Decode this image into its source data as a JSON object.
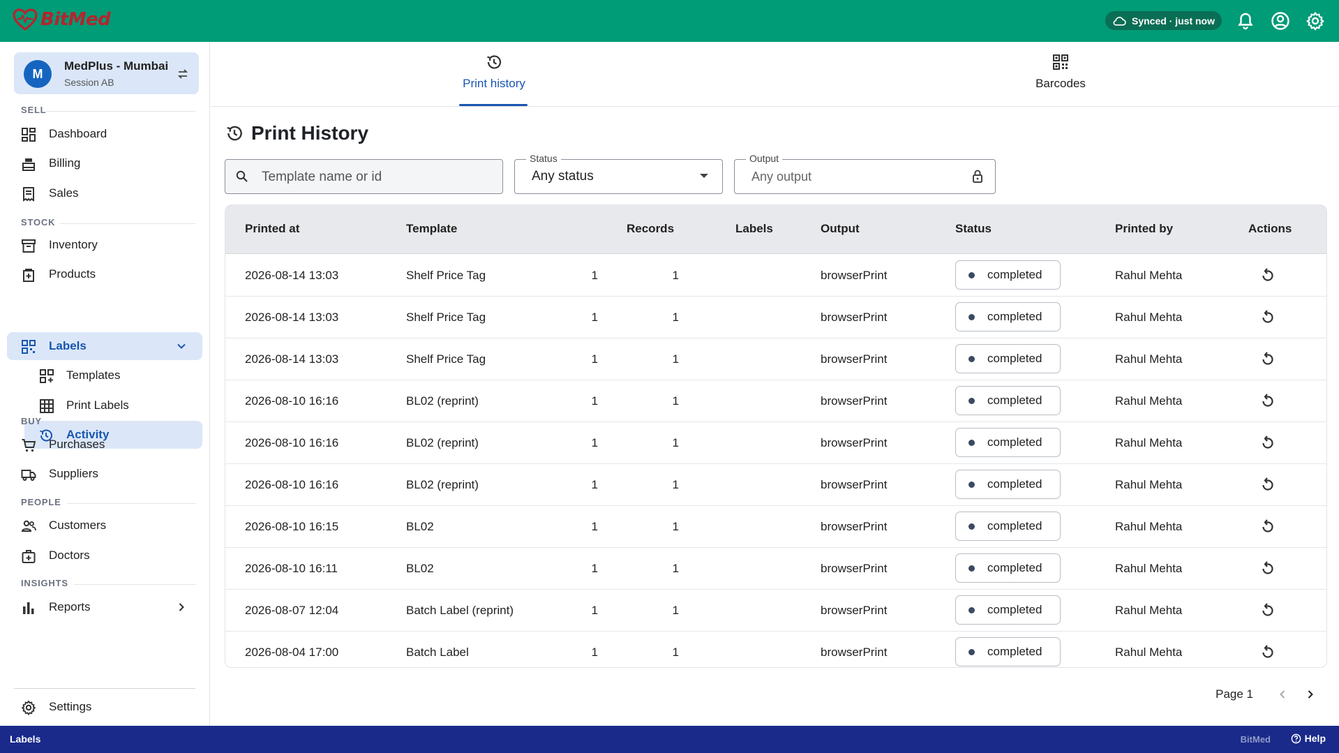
{
  "app": {
    "name": "BitMed"
  },
  "topbar": {
    "sync_text": "Synced · just now",
    "icons": [
      "cloud-icon",
      "bell-icon",
      "account-icon",
      "gear-icon"
    ]
  },
  "store": {
    "avatar": "M",
    "name": "MedPlus - Mumbai",
    "session": "Session AB"
  },
  "sidebar": {
    "sections": {
      "sell": "SELL",
      "stock": "STOCK",
      "buy": "BUY",
      "people": "PEOPLE",
      "insights": "INSIGHTS"
    },
    "items": {
      "dashboard": "Dashboard",
      "billing": "Billing",
      "sales": "Sales",
      "inventory": "Inventory",
      "products": "Products",
      "labels": "Labels",
      "templates": "Templates",
      "print_labels": "Print Labels",
      "activity": "Activity",
      "purchases": "Purchases",
      "suppliers": "Suppliers",
      "customers": "Customers",
      "doctors": "Doctors",
      "reports": "Reports",
      "settings": "Settings"
    }
  },
  "tabs": [
    {
      "label": "Print history",
      "icon": "history-icon",
      "active": true
    },
    {
      "label": "Barcodes",
      "icon": "qr-code-icon",
      "active": false
    }
  ],
  "page": {
    "title": "Print History"
  },
  "filters": {
    "search_placeholder": "Template name or id",
    "status_label": "Status",
    "status_value": "Any status",
    "output_label": "Output",
    "output_placeholder": "Any output"
  },
  "table": {
    "headers": {
      "printed_at": "Printed at",
      "template": "Template",
      "records": "Records",
      "labels": "Labels",
      "output": "Output",
      "status": "Status",
      "printed_by": "Printed by",
      "actions": "Actions"
    },
    "rows": [
      {
        "printed_at": "2026-08-14 13:03",
        "template": "Shelf Price Tag",
        "records": "1",
        "labels": "1",
        "output": "browserPrint",
        "status": "completed",
        "printed_by": "Rahul Mehta"
      },
      {
        "printed_at": "2026-08-14 13:03",
        "template": "Shelf Price Tag",
        "records": "1",
        "labels": "1",
        "output": "browserPrint",
        "status": "completed",
        "printed_by": "Rahul Mehta"
      },
      {
        "printed_at": "2026-08-14 13:03",
        "template": "Shelf Price Tag",
        "records": "1",
        "labels": "1",
        "output": "browserPrint",
        "status": "completed",
        "printed_by": "Rahul Mehta"
      },
      {
        "printed_at": "2026-08-10 16:16",
        "template": "BL02 (reprint)",
        "records": "1",
        "labels": "1",
        "output": "browserPrint",
        "status": "completed",
        "printed_by": "Rahul Mehta"
      },
      {
        "printed_at": "2026-08-10 16:16",
        "template": "BL02 (reprint)",
        "records": "1",
        "labels": "1",
        "output": "browserPrint",
        "status": "completed",
        "printed_by": "Rahul Mehta"
      },
      {
        "printed_at": "2026-08-10 16:16",
        "template": "BL02 (reprint)",
        "records": "1",
        "labels": "1",
        "output": "browserPrint",
        "status": "completed",
        "printed_by": "Rahul Mehta"
      },
      {
        "printed_at": "2026-08-10 16:15",
        "template": "BL02",
        "records": "1",
        "labels": "1",
        "output": "browserPrint",
        "status": "completed",
        "printed_by": "Rahul Mehta"
      },
      {
        "printed_at": "2026-08-10 16:11",
        "template": "BL02",
        "records": "1",
        "labels": "1",
        "output": "browserPrint",
        "status": "completed",
        "printed_by": "Rahul Mehta"
      },
      {
        "printed_at": "2026-08-07 12:04",
        "template": "Batch Label (reprint)",
        "records": "1",
        "labels": "1",
        "output": "browserPrint",
        "status": "completed",
        "printed_by": "Rahul Mehta"
      },
      {
        "printed_at": "2026-08-04 17:00",
        "template": "Batch Label",
        "records": "1",
        "labels": "1",
        "output": "browserPrint",
        "status": "completed",
        "printed_by": "Rahul Mehta"
      }
    ]
  },
  "pagination": {
    "label": "Page 1"
  },
  "footer": {
    "context": "Labels",
    "brand": "BitMed",
    "help": "Help"
  },
  "colors": {
    "topbar": "#009b77",
    "accent": "#1a56b0",
    "active_bg": "#dbe7f8",
    "footer": "#1a2a8a",
    "logo": "#b3262d"
  }
}
